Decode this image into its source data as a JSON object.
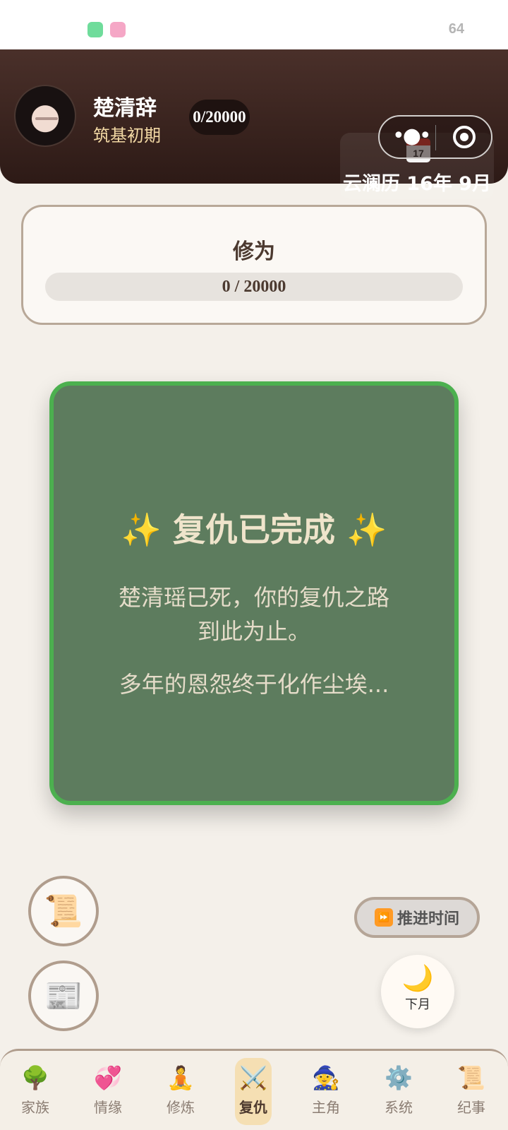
{
  "status_bar": {
    "battery": "64",
    "icons": [
      "wechat-icon",
      "pink-app-icon"
    ]
  },
  "header": {
    "name": "楚清辞",
    "realm": "筑基初期",
    "xp_badge": "0/20000",
    "calendar": {
      "icon_day": "17",
      "text": "云澜历 16年 9月"
    }
  },
  "cultivation": {
    "title": "修为",
    "progress_text": "0 / 20000",
    "progress": 0
  },
  "revenge_card": {
    "title": "✨ 复仇已完成 ✨",
    "line1": "楚清瑶已死，你的复仇之路到此为止。",
    "line2": "多年的恩怨终于化作尘埃..."
  },
  "actions": {
    "scroll_icon": "📜",
    "news_icon": "📰",
    "advance_label": "推进时间",
    "advance_icon": "⏩",
    "next_month_icon": "🌙",
    "next_month_label": "下月"
  },
  "nav": [
    {
      "icon": "🌳",
      "label": "家族"
    },
    {
      "icon": "💞",
      "label": "情缘"
    },
    {
      "icon": "🧘",
      "label": "修炼"
    },
    {
      "icon": "⚔️",
      "label": "复仇",
      "active": true
    },
    {
      "icon": "🧙",
      "label": "主角"
    },
    {
      "icon": "⚙️",
      "label": "系统"
    },
    {
      "icon": "📜",
      "label": "纪事"
    }
  ],
  "colors": {
    "header_bg": "#2d1a16",
    "card_bg": "#5d7c5e",
    "card_border": "#4cb04f",
    "active_tab": "#f5dfb3"
  }
}
